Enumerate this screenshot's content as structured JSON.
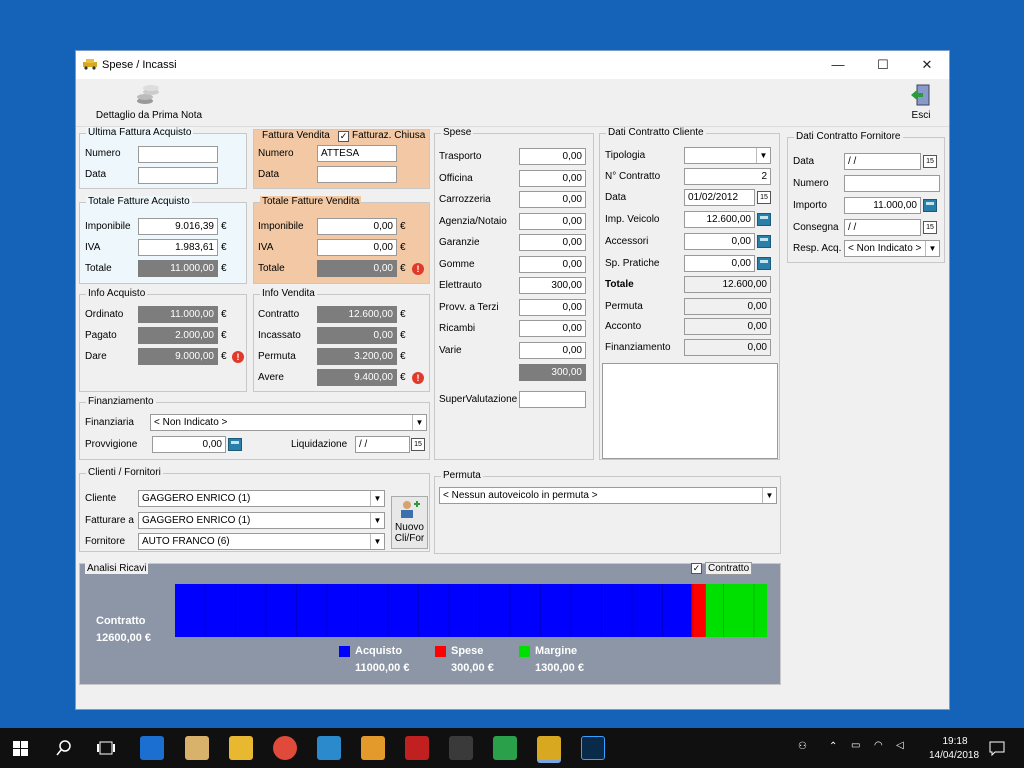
{
  "window": {
    "title": "Spese / Incassi",
    "minimize": "—",
    "maximize": "☐",
    "close": "✕"
  },
  "toolbar": {
    "detail_label": "Dettaglio da Prima Nota",
    "exit_label": "Esci"
  },
  "ultima_fattura_acquisto": {
    "title": "Ultima Fattura Acquisto",
    "numero_label": "Numero",
    "numero_value": "",
    "data_label": "Data",
    "data_value": ""
  },
  "fattura_vendita": {
    "title": "Fattura Vendita",
    "chiusa_label": "Fatturaz. Chiusa",
    "numero_label": "Numero",
    "numero_value": "ATTESA",
    "data_label": "Data",
    "data_value": ""
  },
  "totale_fatture_acquisto": {
    "title": "Totale Fatture Acquisto",
    "imponibile_label": "Imponibile",
    "imponibile": "9.016,39",
    "iva_label": "IVA",
    "iva": "1.983,61",
    "totale_label": "Totale",
    "totale": "11.000,00",
    "currency": "€"
  },
  "totale_fatture_vendita": {
    "title": "Totale Fatture Vendita",
    "imponibile_label": "Imponibile",
    "imponibile": "0,00",
    "iva_label": "IVA",
    "iva": "0,00",
    "totale_label": "Totale",
    "totale": "0,00"
  },
  "info_acquisto": {
    "title": "Info Acquisto",
    "ordinato_label": "Ordinato",
    "ordinato": "11.000,00",
    "pagato_label": "Pagato",
    "pagato": "2.000,00",
    "dare_label": "Dare",
    "dare": "9.000,00"
  },
  "info_vendita": {
    "title": "Info Vendita",
    "contratto_label": "Contratto",
    "contratto": "12.600,00",
    "incassato_label": "Incassato",
    "incassato": "0,00",
    "permuta_label": "Permuta",
    "permuta": "3.200,00",
    "avere_label": "Avere",
    "avere": "9.400,00"
  },
  "finanziamento": {
    "title": "Finanziamento",
    "finanziaria_label": "Finanziaria",
    "finanziaria_value": "< Non Indicato >",
    "provvigione_label": "Provvigione",
    "provvigione_value": "0,00",
    "liquidazione_label": "Liquidazione",
    "liquidazione_value": " / /"
  },
  "spese": {
    "title": "Spese",
    "items": [
      {
        "label": "Trasporto",
        "value": "0,00"
      },
      {
        "label": "Officina",
        "value": "0,00"
      },
      {
        "label": "Carrozzeria",
        "value": "0,00"
      },
      {
        "label": "Agenzia/Notaio",
        "value": "0,00"
      },
      {
        "label": "Garanzie",
        "value": "0,00"
      },
      {
        "label": "Gomme",
        "value": "0,00"
      },
      {
        "label": "Elettrauto",
        "value": "300,00"
      },
      {
        "label": "Provv. a Terzi",
        "value": "0,00"
      },
      {
        "label": "Ricambi",
        "value": "0,00"
      },
      {
        "label": "Varie",
        "value": "0,00"
      }
    ],
    "totale": "300,00",
    "supervalutazione_label": "SuperValutazione",
    "supervalutazione_value": ""
  },
  "dati_contratto_cliente": {
    "title": "Dati Contratto Cliente",
    "tipologia_label": "Tipologia",
    "tipologia_value": "",
    "n_contratto_label": "N° Contratto",
    "n_contratto_value": "2",
    "data_label": "Data",
    "data_value": "01/02/2012",
    "imp_veicolo_label": "Imp. Veicolo",
    "imp_veicolo_value": "12.600,00",
    "accessori_label": "Accessori",
    "accessori_value": "0,00",
    "sp_pratiche_label": "Sp. Pratiche",
    "sp_pratiche_value": "0,00",
    "totale_label": "Totale",
    "totale_value": "12.600,00",
    "permuta_label": "Permuta",
    "permuta_value": "0,00",
    "acconto_label": "Acconto",
    "acconto_value": "0,00",
    "finanziamento_label": "Finanziamento",
    "finanziamento_value": "0,00"
  },
  "dati_contratto_fornitore": {
    "title": "Dati Contratto Fornitore",
    "data_label": "Data",
    "data_value": " / /",
    "numero_label": "Numero",
    "numero_value": "",
    "importo_label": "Importo",
    "importo_value": "11.000,00",
    "consegna_label": "Consegna",
    "consegna_value": " / /",
    "resp_label": "Resp. Acq.",
    "resp_value": "< Non Indicato >"
  },
  "clienti_fornitori": {
    "title": "Clienti / Fornitori",
    "cliente_label": "Cliente",
    "cliente_value": "GAGGERO ENRICO  (1)",
    "fatturare_label": "Fatturare a",
    "fatturare_value": "GAGGERO ENRICO  (1)",
    "fornitore_label": "Fornitore",
    "fornitore_value": "AUTO FRANCO (6)",
    "nuovo_label_1": "Nuovo",
    "nuovo_label_2": "Cli/For"
  },
  "permuta": {
    "title": "Permuta",
    "value": "< Nessun autoveicolo in permuta >"
  },
  "analisi_ricavi": {
    "title": "Analisi Ricavi",
    "contratto_check_label": "Contratto",
    "contratto_label": "Contratto",
    "contratto_value": "12600,00 €",
    "legend": [
      {
        "name": "Acquisto",
        "value": "11000,00 €",
        "color": "#0000ff"
      },
      {
        "name": "Spese",
        "value": "300,00 €",
        "color": "#ff0000"
      },
      {
        "name": "Margine",
        "value": "1300,00 €",
        "color": "#00e000"
      }
    ]
  },
  "chart_data": {
    "type": "bar",
    "categories": [
      "Acquisto",
      "Spese",
      "Margine"
    ],
    "values": [
      11000,
      300,
      1300
    ],
    "title": "",
    "xlabel": "",
    "ylabel": "",
    "colors": [
      "#0000ff",
      "#ff0000",
      "#00e000"
    ]
  },
  "taskbar": {
    "time": "19:18",
    "date": "14/04/2018"
  }
}
